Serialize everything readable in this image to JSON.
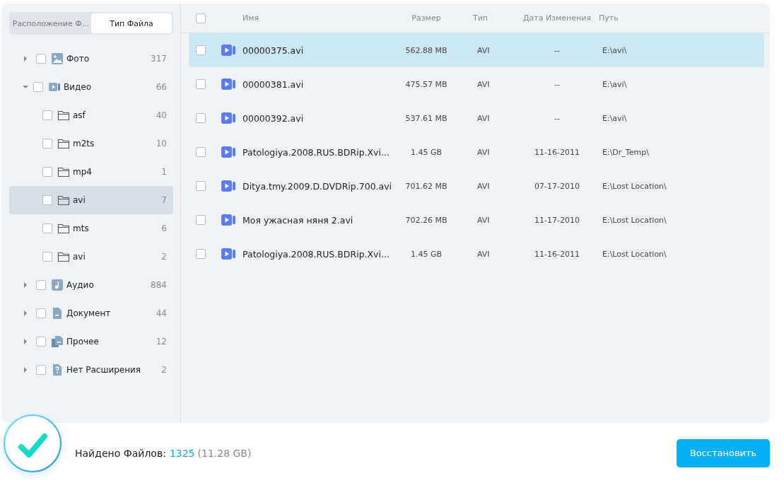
{
  "sidebar": {
    "tabs": [
      {
        "label": "Расположение Ф...",
        "selected": false
      },
      {
        "label": "Тип Файла",
        "selected": true
      }
    ],
    "tree": [
      {
        "kind": "photo",
        "label": "Фото",
        "count": "317",
        "checked": false,
        "expanded": false,
        "selected": false
      },
      {
        "kind": "video",
        "label": "Видео",
        "count": "66",
        "checked": false,
        "expanded": true,
        "selected": false,
        "children": [
          {
            "kind": "folder",
            "label": "asf",
            "count": "40",
            "checked": false,
            "selected": false
          },
          {
            "kind": "folder",
            "label": "m2ts",
            "count": "10",
            "checked": false,
            "selected": false
          },
          {
            "kind": "folder",
            "label": "mp4",
            "count": "1",
            "checked": false,
            "selected": false
          },
          {
            "kind": "folder",
            "label": "avi",
            "count": "7",
            "checked": false,
            "selected": true
          },
          {
            "kind": "folder",
            "label": "mts",
            "count": "6",
            "checked": false,
            "selected": false
          },
          {
            "kind": "folder",
            "label": "avi",
            "count": "2",
            "checked": false,
            "selected": false
          }
        ]
      },
      {
        "kind": "audio",
        "label": "Аудио",
        "count": "884",
        "checked": false,
        "expanded": false,
        "selected": false
      },
      {
        "kind": "document",
        "label": "Документ",
        "count": "44",
        "checked": false,
        "expanded": false,
        "selected": false
      },
      {
        "kind": "other",
        "label": "Прочее",
        "count": "12",
        "checked": false,
        "expanded": false,
        "selected": false
      },
      {
        "kind": "unknown",
        "label": "Нет Расширения",
        "count": "2",
        "checked": false,
        "expanded": false,
        "selected": false
      }
    ]
  },
  "table": {
    "all_checked": false,
    "columns": [
      "Имя",
      "Размер",
      "Тип",
      "Дата Изменения",
      "Путь"
    ],
    "rows": [
      {
        "name": "00000375.avi",
        "size": "562.88 MB",
        "type": "AVI",
        "date": "--",
        "path": "E:\\avi\\",
        "checked": false,
        "selected": true
      },
      {
        "name": "00000381.avi",
        "size": "475.57 MB",
        "type": "AVI",
        "date": "--",
        "path": "E:\\avi\\",
        "checked": false,
        "selected": false
      },
      {
        "name": "00000392.avi",
        "size": "537.61 MB",
        "type": "AVI",
        "date": "--",
        "path": "E:\\avi\\",
        "checked": false,
        "selected": false
      },
      {
        "name": "Patologiya.2008.RUS.BDRip.Xvi...",
        "size": "1.45 GB",
        "type": "AVI",
        "date": "11-16-2011",
        "path": "E:\\Dr_Temp\\",
        "checked": false,
        "selected": false
      },
      {
        "name": "Ditya.tmy.2009.D.DVDRip.700.avi",
        "size": "701.62 MB",
        "type": "AVI",
        "date": "07-17-2010",
        "path": "E:\\Lost Location\\",
        "checked": false,
        "selected": false
      },
      {
        "name": "Моя ужасная няня 2.avi",
        "size": "702.26 MB",
        "type": "AVI",
        "date": "11-17-2010",
        "path": "E:\\Lost Location\\",
        "checked": false,
        "selected": false
      },
      {
        "name": "Patologiya.2008.RUS.BDRip.Xvi...",
        "size": "1.45 GB",
        "type": "AVI",
        "date": "11-16-2011",
        "path": "E:\\Lost Location\\",
        "checked": false,
        "selected": false
      }
    ]
  },
  "footer": {
    "label": "Найдено Файлов:",
    "count": "1325",
    "size": "(11.28 GB)",
    "button": "Восстановить"
  }
}
